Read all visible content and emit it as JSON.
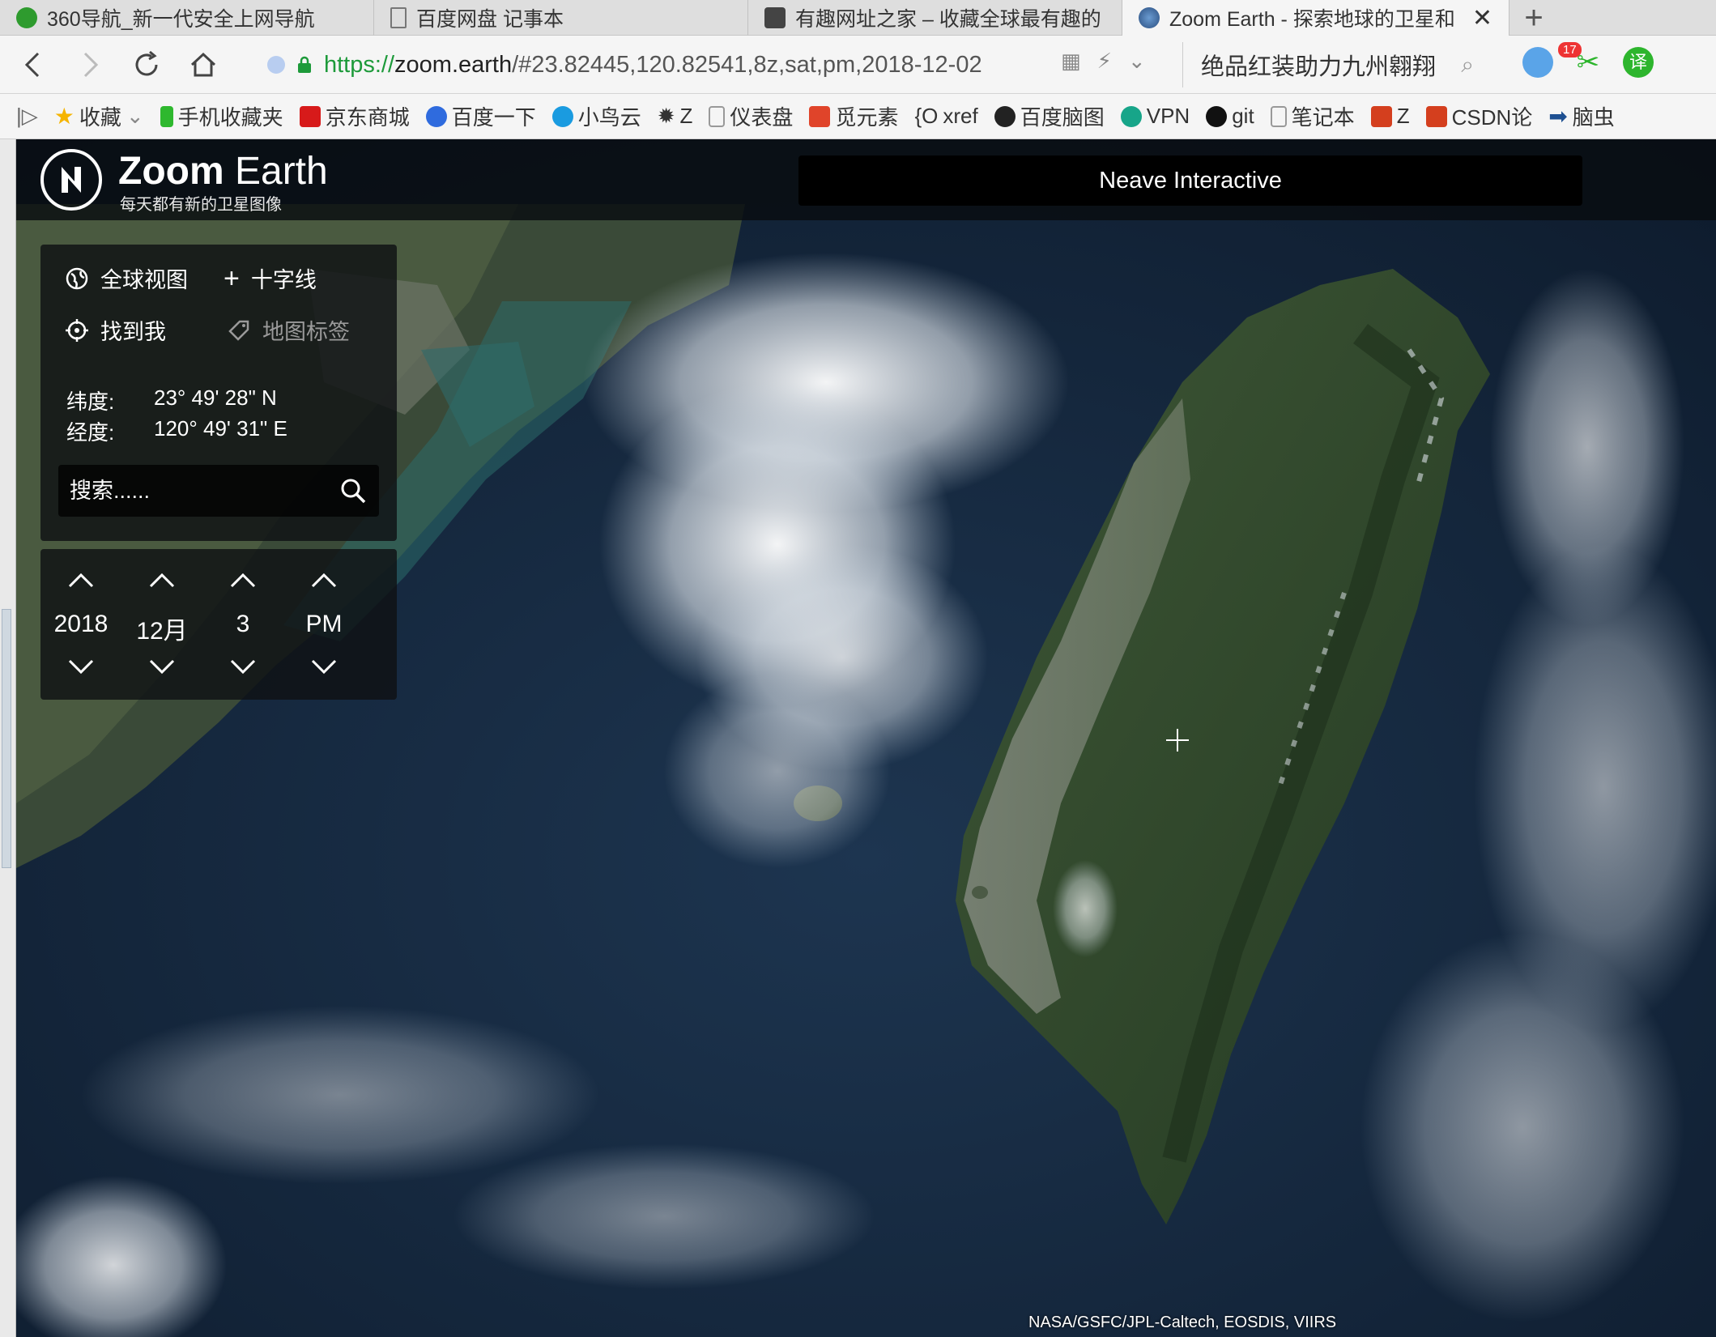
{
  "tabs": [
    {
      "title": "360导航_新一代安全上网导航",
      "favicon_color": "#2e9b2e",
      "active": false
    },
    {
      "title": "百度网盘 记事本",
      "favicon_color": "#ffffff",
      "active": false
    },
    {
      "title": "有趣网址之家 – 收藏全球最有趣的",
      "favicon_color": "#444444",
      "active": false
    },
    {
      "title": "Zoom Earth - 探索地球的卫星和",
      "favicon_color": "#3b6fa8",
      "active": true
    }
  ],
  "urlbar": {
    "scheme": "https://",
    "host": "zoom.earth",
    "path": "/#23.82445,120.82541,8z,sat,pm,2018-12-02"
  },
  "searchbox": {
    "text": "绝品红装助力九州翱翔"
  },
  "extensions": {
    "badge": "17"
  },
  "bookmarks": [
    {
      "label": "收藏",
      "icon": "star-icon",
      "color": "#f5b400"
    },
    {
      "label": "手机收藏夹",
      "icon": "phone-icon",
      "color": "#2eb82e"
    },
    {
      "label": "京东商城",
      "icon": "jd-icon",
      "color": "#d71a1a"
    },
    {
      "label": "百度一下",
      "icon": "baidu-icon",
      "color": "#2f6bde"
    },
    {
      "label": "小鸟云",
      "icon": "cloud-icon",
      "color": "#1a9be0"
    },
    {
      "label": "Z",
      "icon": "gear-icon",
      "color": "#333333"
    },
    {
      "label": "仪表盘",
      "icon": "page-icon",
      "color": "#888888"
    },
    {
      "label": "觅元素",
      "icon": "mi-icon",
      "color": "#e0442a"
    },
    {
      "label": "xref",
      "icon": "brace-icon",
      "color": "#333333"
    },
    {
      "label": "百度脑图",
      "icon": "mind-icon",
      "color": "#222222"
    },
    {
      "label": "VPN",
      "icon": "vpn-icon",
      "color": "#17a589"
    },
    {
      "label": "git",
      "icon": "github-icon",
      "color": "#111111"
    },
    {
      "label": "笔记本",
      "icon": "page-icon",
      "color": "#888888"
    },
    {
      "label": "Z",
      "icon": "csdn-icon",
      "color": "#d43f1e"
    },
    {
      "label": "CSDN论",
      "icon": "csdn-icon",
      "color": "#d43f1e"
    },
    {
      "label": "脑虫",
      "icon": "arrow-icon",
      "color": "#1d4f91"
    }
  ],
  "app": {
    "brand_bold": "Zoom",
    "brand_light": " Earth",
    "tagline": "每天都有新的卫星图像",
    "banner": "Neave Interactive"
  },
  "panel": {
    "global_view": "全球视图",
    "crosshair": "十字线",
    "find_me": "找到我",
    "map_labels": "地图标签",
    "lat_label": "纬度:",
    "lat_value": "23° 49' 28\" N",
    "lon_label": "经度:",
    "lon_value": "120° 49' 31\" E",
    "search_placeholder": "搜索......"
  },
  "date": {
    "year": "2018",
    "month": "12月",
    "day": "3",
    "period": "PM"
  },
  "attribution": "NASA/GSFC/JPL-Caltech, EOSDIS, VIIRS"
}
